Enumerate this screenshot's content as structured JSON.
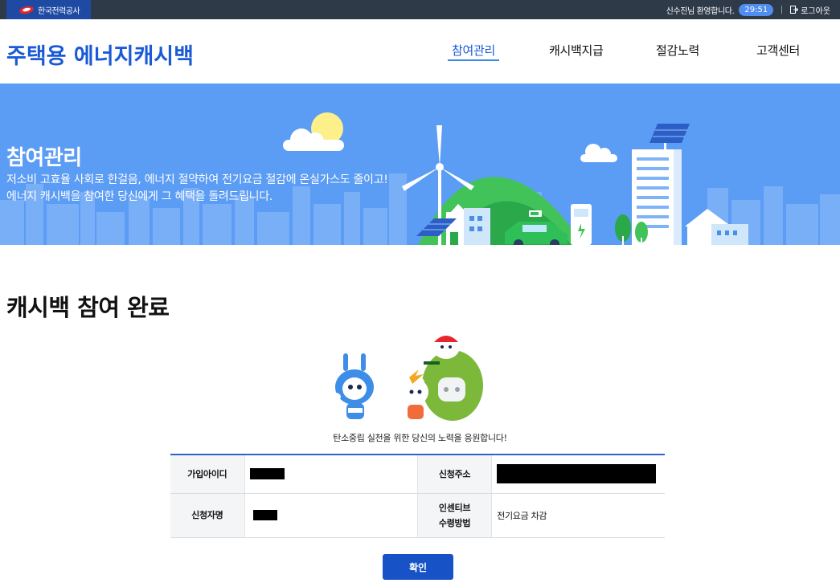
{
  "topbar": {
    "org_name": "한국전력공사",
    "welcome_text": "신수진님 환영합니다.",
    "session_timer": "29:51",
    "logout_label": "로그아웃"
  },
  "header": {
    "site_title": "주택용 에너지캐시백",
    "nav": [
      {
        "label": "참여관리",
        "active": true
      },
      {
        "label": "캐시백지급",
        "active": false
      },
      {
        "label": "절감노력",
        "active": false
      },
      {
        "label": "고객센터",
        "active": false
      }
    ]
  },
  "banner": {
    "title": "참여관리",
    "desc_line1": "저소비 고효율 사회로 한걸음, 에너지 절약하여 전기요금 절감에 온실가스도 줄이고!",
    "desc_line2": "에너지 캐시백을 참여한 당신에게 그 혜택을 돌려드립니다."
  },
  "main": {
    "heading": "캐시백 참여 완료",
    "cheer_text": "탄소중립 실천을 위한 당신의 노력을 응원합니다!",
    "table": {
      "join_id_label": "가입아이디",
      "address_label": "신청주소",
      "applicant_label": "신청자명",
      "incentive_label_line1": "인센티브",
      "incentive_label_line2": "수령방법",
      "incentive_value": "전기요금 차감"
    },
    "confirm_label": "확인"
  },
  "colors": {
    "brand_blue": "#1a5ad6",
    "topbar_bg": "#2f3a48",
    "banner_bg": "#5b9cf5",
    "button_bg": "#1753c7"
  }
}
